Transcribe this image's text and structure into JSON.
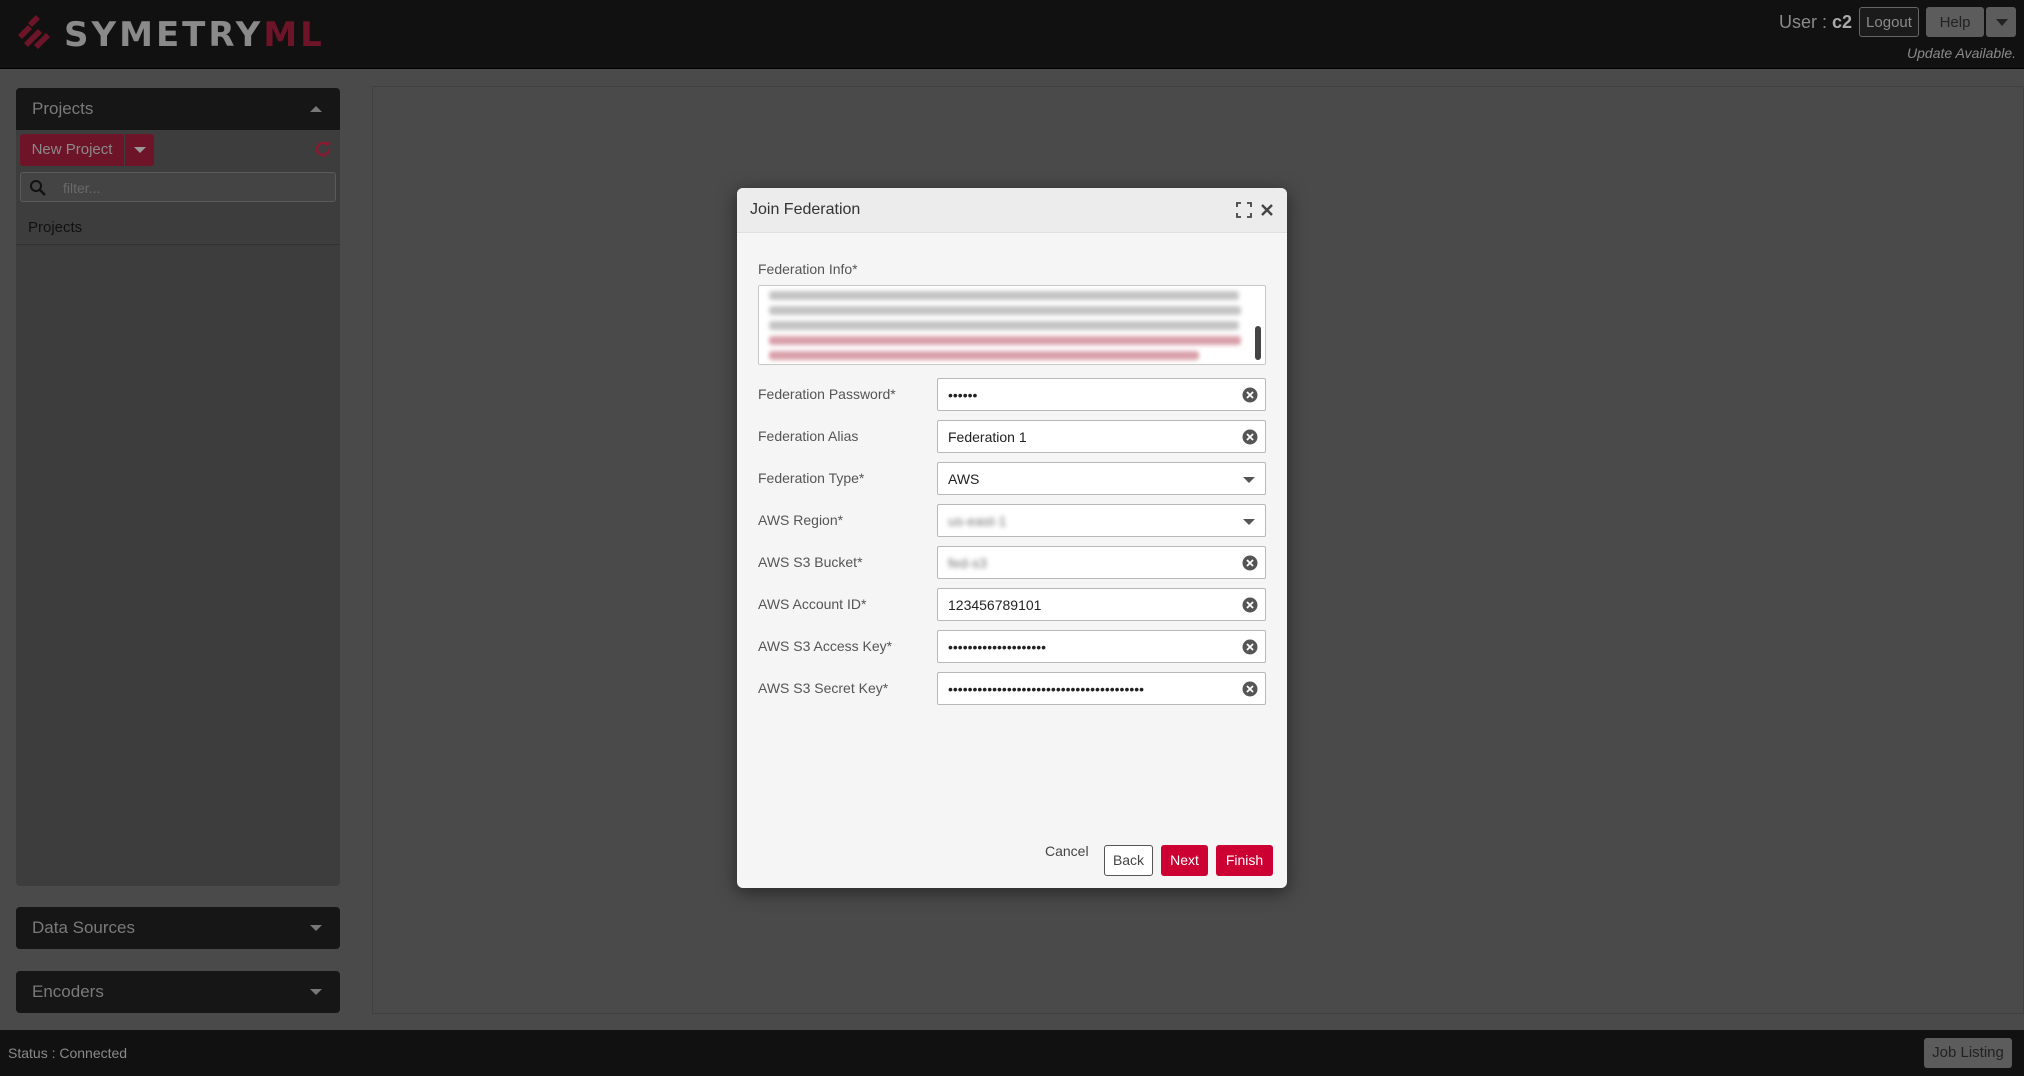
{
  "header": {
    "logo_main": "SYMETRY",
    "logo_accent": "ML",
    "user_label": "User : ",
    "user_name": "c2",
    "logout_label": "Logout",
    "help_label": "Help",
    "update_text": "Update Available."
  },
  "sidebar": {
    "projects_title": "Projects",
    "new_project_label": "New Project",
    "filter_placeholder": "filter...",
    "projects_list_label": "Projects",
    "data_sources_title": "Data Sources",
    "encoders_title": "Encoders"
  },
  "status": {
    "text": "Status : Connected",
    "job_listing_label": "Job Listing"
  },
  "modal": {
    "title": "Join Federation",
    "federation_info_label": "Federation Info*",
    "fields": [
      {
        "label": "Federation Password*",
        "value": "••••••",
        "type": "text-clear"
      },
      {
        "label": "Federation Alias",
        "value": "Federation 1",
        "type": "text-clear"
      },
      {
        "label": "Federation Type*",
        "value": "AWS",
        "type": "select"
      },
      {
        "label": "AWS Region*",
        "value": "us-east-1",
        "type": "select"
      },
      {
        "label": "AWS S3 Bucket*",
        "value": "fed-s3",
        "type": "text-clear"
      },
      {
        "label": "AWS Account ID*",
        "value": "123456789101",
        "type": "text-clear"
      },
      {
        "label": "AWS S3 Access Key*",
        "value": "••••••••••••••••••••",
        "type": "text-clear"
      },
      {
        "label": "AWS S3 Secret Key*",
        "value": "••••••••••••••••••••••••••••••••••••••••",
        "type": "text-clear"
      }
    ],
    "cancel_label": "Cancel",
    "back_label": "Back",
    "next_label": "Next",
    "finish_label": "Finish"
  },
  "colors": {
    "accent": "#cc0033",
    "accent_dim": "#6d1428",
    "topbar": "#111111",
    "overlay": "#4a4a4a"
  },
  "icons": {
    "logo": "symetryml-logo-icon",
    "refresh": "refresh-icon",
    "search": "search-icon",
    "maximize": "maximize-icon",
    "close": "close-icon",
    "clear": "clear-circle-icon",
    "dropdown": "chevron-down-icon"
  }
}
